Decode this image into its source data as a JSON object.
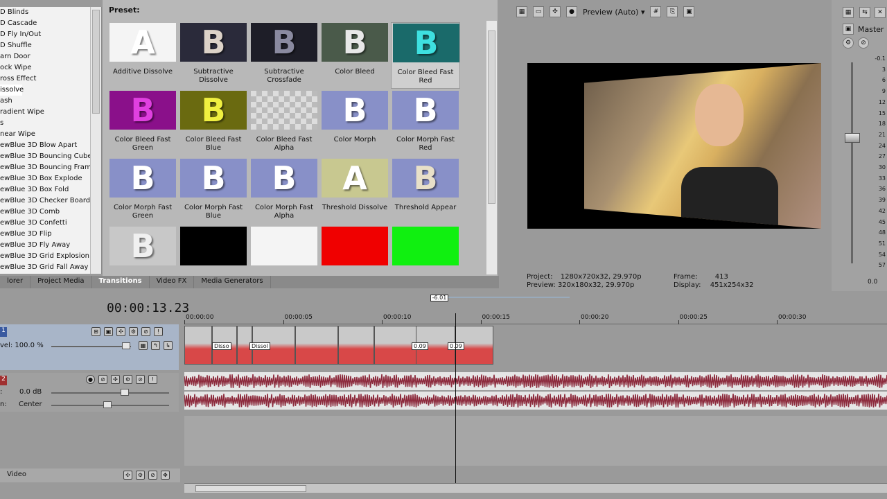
{
  "transitions_list": {
    "items": [
      "D Blinds",
      "D Cascade",
      "D Fly In/Out",
      "D Shuffle",
      "arn Door",
      "ock Wipe",
      "ross Effect",
      "issolve",
      "ash",
      "radient Wipe",
      "s",
      "near Wipe",
      "ewBlue 3D Blow Apart",
      "ewBlue 3D Bouncing Cubes",
      "ewBlue 3D Bouncing Frames",
      "ewBlue 3D Box Explode",
      "ewBlue 3D Box Fold",
      "ewBlue 3D Checker Board",
      "ewBlue 3D Comb",
      "ewBlue 3D Confetti",
      "ewBlue 3D Flip",
      "ewBlue 3D Fly Away",
      "ewBlue 3D Grid Explosion",
      "ewBlue 3D Grid Fall Away"
    ],
    "selected_index": 7
  },
  "preset": {
    "title": "Preset:",
    "items": [
      {
        "label": "Additive Dissolve",
        "letter": "A",
        "bg": "#f4f4f4",
        "fg": "#ffffff"
      },
      {
        "label": "Subtractive Dissolve",
        "letter": "B",
        "bg": "#2a2a3a",
        "fg": "#dcd2c8"
      },
      {
        "label": "Subtractive Crossfade",
        "letter": "B",
        "bg": "#1e1e28",
        "fg": "#8a8aa0"
      },
      {
        "label": "Color Bleed",
        "letter": "B",
        "bg": "#4a5a4a",
        "fg": "#e8e8e8"
      },
      {
        "label": "Color Bleed Fast Red",
        "letter": "B",
        "bg": "#1a6a6a",
        "fg": "#3ee0e0"
      },
      {
        "label": "Color Bleed Fast Green",
        "letter": "B",
        "bg": "#8a108a",
        "fg": "#e040e0"
      },
      {
        "label": "Color Bleed Fast Blue",
        "letter": "B",
        "bg": "#6a6a10",
        "fg": "#f0f040"
      },
      {
        "label": "Color Bleed Fast Alpha",
        "letter": "",
        "bg": "checker",
        "fg": "#ffffff"
      },
      {
        "label": "Color Morph",
        "letter": "B",
        "bg": "#8890c8",
        "fg": "#ffffff"
      },
      {
        "label": "Color Morph Fast Red",
        "letter": "B",
        "bg": "#8890c8",
        "fg": "#ffffff"
      },
      {
        "label": "Color Morph Fast Green",
        "letter": "B",
        "bg": "#8890c8",
        "fg": "#ffffff"
      },
      {
        "label": "Color Morph Fast Blue",
        "letter": "B",
        "bg": "#8890c8",
        "fg": "#ffffff"
      },
      {
        "label": "Color Morph Fast Alpha",
        "letter": "B",
        "bg": "#8890c8",
        "fg": "#ffffff"
      },
      {
        "label": "Threshold Dissolve",
        "letter": "A",
        "bg": "#c8c890",
        "fg": "#ffffff"
      },
      {
        "label": "Threshold Appear",
        "letter": "B",
        "bg": "#8890c8",
        "fg": "#e8e0c8"
      },
      {
        "label": "",
        "letter": "B",
        "bg": "#c8c8c8",
        "fg": "#f0f0f0"
      },
      {
        "label": "",
        "letter": "",
        "bg": "#000000",
        "fg": "#000000"
      },
      {
        "label": "",
        "letter": "",
        "bg": "#f4f4f4",
        "fg": "#ffffff"
      },
      {
        "label": "",
        "letter": "",
        "bg": "#f00000",
        "fg": "#ff0000"
      },
      {
        "label": "",
        "letter": "",
        "bg": "#10f010",
        "fg": "#00ff00"
      }
    ],
    "selected_index": 4
  },
  "tabs": [
    {
      "label": "lorer",
      "active": false
    },
    {
      "label": "Project Media",
      "active": false
    },
    {
      "label": "Transitions",
      "active": true
    },
    {
      "label": "Video FX",
      "active": false
    },
    {
      "label": "Media Generators",
      "active": false
    }
  ],
  "preview": {
    "mode_label": "Preview (Auto)",
    "project_label": "Project:",
    "project_value": "1280x720x32, 29.970p",
    "preview_label": "Preview:",
    "preview_value": "320x180x32, 29.970p",
    "frame_label": "Frame:",
    "frame_value": "413",
    "display_label": "Display:",
    "display_value": "451x254x32"
  },
  "master": {
    "label": "Master",
    "meter_ticks": [
      "-0.1",
      "3",
      "6",
      "9",
      "12",
      "15",
      "18",
      "21",
      "24",
      "27",
      "30",
      "33",
      "36",
      "39",
      "42",
      "45",
      "48",
      "51",
      "54",
      "57"
    ],
    "value": "0.0"
  },
  "timeline": {
    "time_code": "00:00:13.23",
    "loop_marker": "-6.01",
    "ruler_labels": [
      "00:00:00",
      "00:00:05",
      "00:00:10",
      "00:00:15",
      "00:00:20",
      "00:00:25",
      "00:00:30"
    ],
    "video_track": {
      "number": "1",
      "level_label": "vel: 100.0 %"
    },
    "audio_track": {
      "number": "2",
      "volume_label": "0.0 dB",
      "pan_label_prefix": "n:",
      "pan_value": "Center"
    },
    "clip_tags": [
      "Disso",
      "Dissol",
      "0.09",
      "0.09"
    ],
    "bus_label": "Video"
  },
  "colors": {
    "audio_wave": "#8c2a3c",
    "clip_red": "#d84848",
    "video_header": "#a8b5c8"
  }
}
